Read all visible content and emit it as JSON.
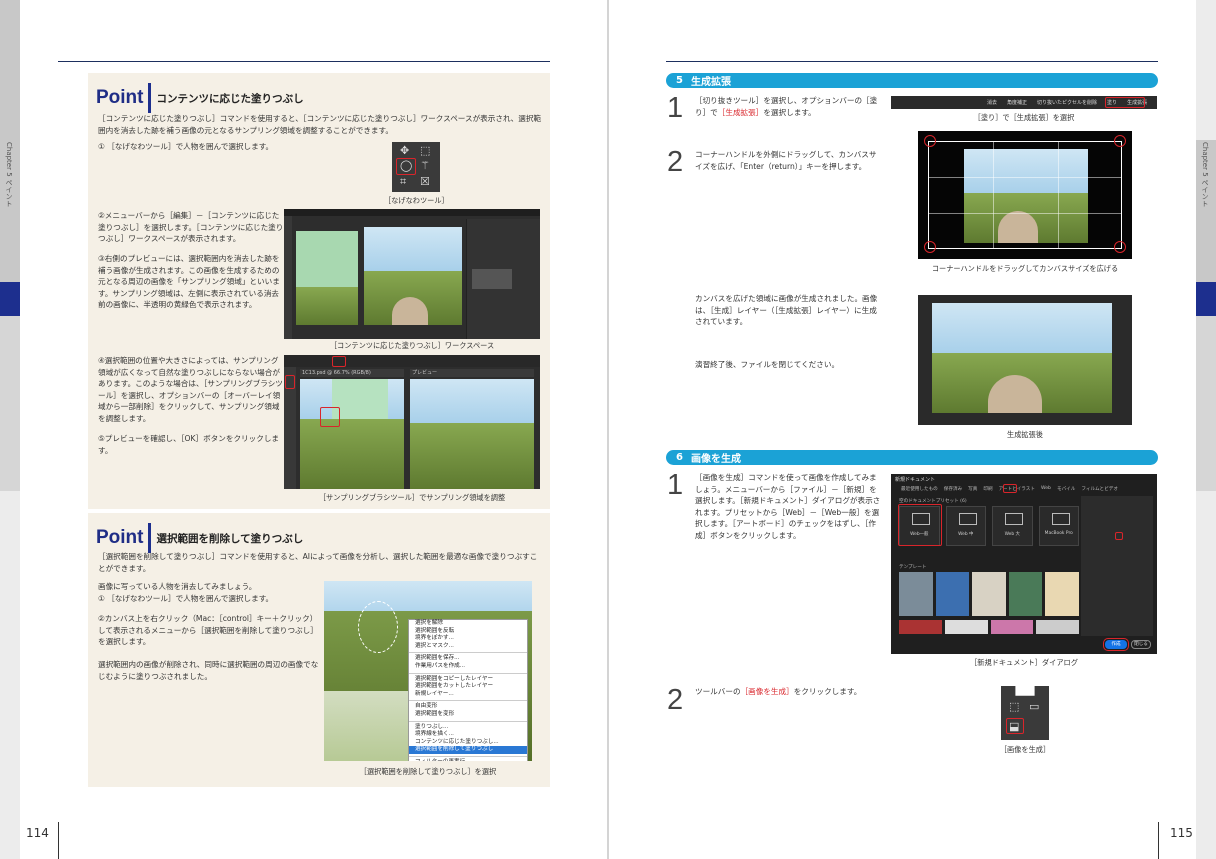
{
  "left_page": {
    "edge_label": "Chapter 5 ペイント",
    "page_number": "114",
    "point1": {
      "word": "Point",
      "title": "コンテンツに応じた塗りつぶし",
      "intro": "［コンテンツに応じた塗りつぶし］コマンドを使用すると、［コンテンツに応じた塗りつぶし］ワークスペースが表示され、選択範囲内を消去した跡を補う画像の元となるサンプリング領域を調整することができます。",
      "step1": "① ［なげなわツール］で人物を囲んで選択します。",
      "cap_lasso": "［なげなわツール］",
      "step2": "②メニューバーから［編集］－［コンテンツに応じた塗りつぶし］を選択します。［コンテンツに応じた塗りつぶし］ワークスペースが表示されます。",
      "step3": "③右側のプレビューには、選択範囲内を消去した跡を補う画像が生成されます。この画像を生成するための元となる周辺の画像を「サンプリング領域」といいます。サンプリング領域は、左側に表示されている消去前の画像に、半透明の黄緑色で表示されます。",
      "cap_workspace": "［コンテンツに応じた塗りつぶし］ワークスペース",
      "step4": "④選択範囲の位置や大きさによっては、サンプリング領域が広くなって自然な塗りつぶしにならない場合があります。このような場合は、［サンプリングブラシツール］を選択し、オプションバーの［オーバーレイ領域から一部削除］をクリックして、サンプリング領域を調整します。",
      "step5": "⑤プレビューを確認し、［OK］ボタンをクリックします。",
      "cap_brush": "［サンプリングブラシツール］でサンプリング領域を調整",
      "file_tab": "1C13.psd @ 66.7% (RGB/8)",
      "preview_tab": "プレビュー"
    },
    "point2": {
      "word": "Point",
      "title": "選択範囲を削除して塗りつぶし",
      "intro": "［選択範囲を削除して塗りつぶし］コマンドを使用すると、AIによって画像を分析し、選択した範囲を最適な画像で塗りつぶすことができます。",
      "body1": "画像に写っている人物を消去してみましょう。",
      "step1": "① ［なげなわツール］で人物を囲んで選択します。",
      "step2": "②カンバス上を右クリック（Mac：［control］キー＋クリック）して表示されるメニューから［選択範囲を削除して塗りつぶし］を選択します。",
      "body2": "選択範囲内の画像が削除され、同時に選択範囲の周辺の画像でなじむように塗りつぶされました。",
      "cap": "［選択範囲を削除して塗りつぶし］を選択",
      "menu_items": [
        "選択を解除",
        "選択範囲を反転",
        "境界をぼかす...",
        "選択とマスク...",
        "-",
        "選択範囲を保存...",
        "作業用パスを作成...",
        "-",
        "選択範囲をコピーしたレイヤー",
        "選択範囲をカットしたレイヤー",
        "新規レイヤー...",
        "-",
        "自由変形",
        "選択範囲を変形",
        "-",
        "塗りつぶし...",
        "境界線を描く...",
        "コンテンツに応じた塗りつぶし...",
        "選択範囲を削除して塗りつぶし",
        "-",
        "フィルターの再実行"
      ],
      "menu_active": "選択範囲を削除して塗りつぶし"
    }
  },
  "right_page": {
    "edge_label": "Chapter 5 ペイント",
    "page_number": "115",
    "section5": {
      "num": "5",
      "title": "生成拡張",
      "step1_num": "1",
      "step1_pre": "［切り抜きツール］を選択し、オプションバーの［塗り］で",
      "step1_red": "［生成拡張］",
      "step1_post": "を選択します。",
      "cap_options": "［塗り］で［生成拡張］を選択",
      "options_labels": [
        "消去",
        "角度補正",
        "切り抜いたピクセルを削除",
        "塗り",
        "生成拡張"
      ],
      "step2_num": "2",
      "step2": "コーナーハンドルを外側にドラッグして、カンバスサイズを広げ、「Enter（return）」キーを押します。",
      "cap_handles": "コーナーハンドルをドラッグしてカンバスサイズを広げる",
      "body": "カンバスを広げた領域に画像が生成されました。画像は、［生成］レイヤー（［生成拡張］レイヤー）に生成されています。",
      "body2": "演習終了後、ファイルを閉じてください。",
      "cap_after": "生成拡張後"
    },
    "section6": {
      "num": "6",
      "title": "画像を生成",
      "step1_num": "1",
      "step1": "［画像を生成］コマンドを使って画像を作成してみましょう。メニューバーから［ファイル］－［新規］を選択します。［新規ドキュメント］ダイアログが表示されます。プリセットから［Web］－［Web一般］を選択します。［アートボード］のチェックをはずし、［作成］ボタンをクリックします。",
      "cap_dialog": "［新規ドキュメント］ダイアログ",
      "dialog_title": "新規ドキュメント",
      "dialog_tabs": [
        "最近使用したもの",
        "保存済み",
        "写真",
        "印刷",
        "アートとイラスト",
        "Web",
        "モバイル",
        "フィルムとビデオ"
      ],
      "dialog_section": "空のドキュメントプリセット (6)",
      "dialog_presets": [
        "Web一般",
        "Web 中",
        "Web 大",
        "MacBook Pro"
      ],
      "dialog_templates_label": "テンプレート",
      "dialog_create": "作成",
      "dialog_close": "閉じる",
      "step2_num": "2",
      "step2_pre": "ツールバーの",
      "step2_red": "［画像を生成］",
      "step2_post": "をクリックします。",
      "cap_tool": "［画像を生成］"
    }
  },
  "colors": {
    "navy": "#1d2f8e",
    "cyan": "#1ba2d6",
    "highlight_red": "#d9252b",
    "point_bg": "#f5f0e6"
  }
}
